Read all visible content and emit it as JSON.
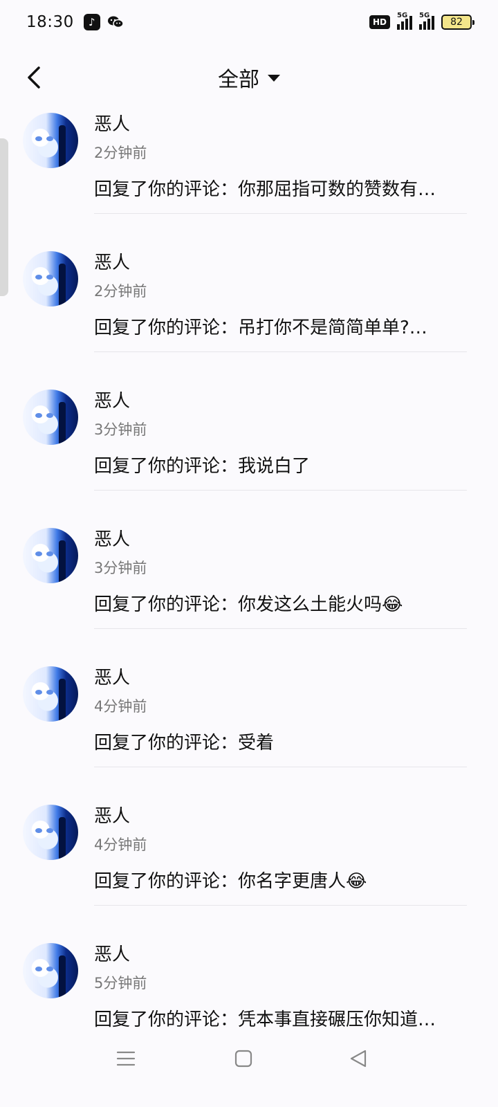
{
  "status_bar": {
    "time": "18:30",
    "app_icons": [
      "tiktok-icon",
      "wechat-icon"
    ],
    "hd_label": "HD",
    "network_1": "5G",
    "network_2": "5G",
    "battery": "82"
  },
  "header": {
    "title": "全部"
  },
  "comments": [
    {
      "name": "恶人",
      "time": "2分钟前",
      "content": "回复了你的评论：你那屈指可数的赞数有…"
    },
    {
      "name": "恶人",
      "time": "2分钟前",
      "content": "回复了你的评论：吊打你不是简简单单?…"
    },
    {
      "name": "恶人",
      "time": "3分钟前",
      "content": "回复了你的评论：我说白了"
    },
    {
      "name": "恶人",
      "time": "3分钟前",
      "content": "回复了你的评论：你发这么土能火吗😂"
    },
    {
      "name": "恶人",
      "time": "4分钟前",
      "content": "回复了你的评论：受着"
    },
    {
      "name": "恶人",
      "time": "4分钟前",
      "content": "回复了你的评论：你名字更唐人😂"
    },
    {
      "name": "恶人",
      "time": "5分钟前",
      "content": "回复了你的评论：凭本事直接碾压你知道…"
    }
  ]
}
